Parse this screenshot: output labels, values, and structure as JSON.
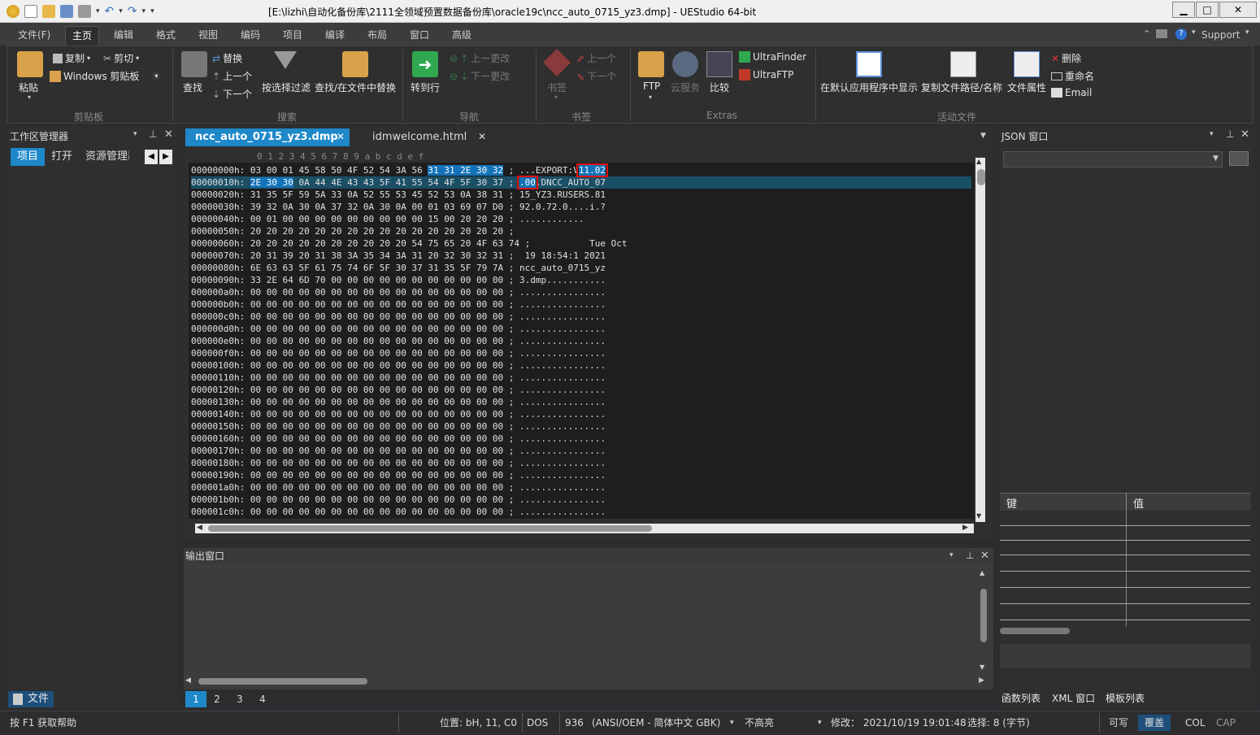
{
  "window": {
    "title": "[E:\\lizhi\\自动化备份库\\2111全领域预置数据备份库\\oracle19c\\ncc_auto_0715_yz3.dmp] - UEStudio 64-bit",
    "minimize": "▁",
    "maximize": "□",
    "close": "✕"
  },
  "menu": {
    "tabs": [
      "文件(F)",
      "主页",
      "编辑",
      "格式",
      "视图",
      "编码",
      "项目",
      "编译",
      "布局",
      "窗口",
      "高级"
    ],
    "active": "主页",
    "support": "Support"
  },
  "ribbon": {
    "clipboard": {
      "paste": "粘贴",
      "copy": "复制",
      "cut": "剪切",
      "windows_clipboard": "Windows 剪贴板",
      "label": "剪贴板"
    },
    "search": {
      "find": "查找",
      "replace": "替换",
      "prev": "上一个",
      "next": "下一个",
      "filter": "按选择过滤",
      "find_in_files": "查找/在文件中替换",
      "label": "搜索"
    },
    "nav": {
      "goto": "转到行",
      "prev_change": "上一更改",
      "next_change": "下一更改",
      "label": "导航"
    },
    "bookmarks": {
      "bookmark": "书签",
      "prev": "上一个",
      "next": "下一个",
      "label": "书签"
    },
    "extras": {
      "ftp": "FTP",
      "cloud": "云服务",
      "compare": "比较",
      "ultrafinder": "UltraFinder",
      "ultraftp": "UltraFTP",
      "label": "Extras"
    },
    "active_file": {
      "show_default": "在默认应用程序中显示",
      "copy_path": "复制文件路径/名称",
      "file_props": "文件属性",
      "delete": "删除",
      "rename": "重命名",
      "email": "Email",
      "label": "活动文件"
    }
  },
  "workspace": {
    "title": "工作区管理器",
    "tabs": [
      "项目",
      "打开",
      "资源管理器"
    ],
    "bottom_tab": "文件"
  },
  "editor": {
    "tabs": [
      {
        "label": "ncc_auto_0715_yz3.dmp",
        "active": true
      },
      {
        "label": "idmwelcome.html",
        "active": false
      }
    ],
    "column_header": "0 1 2 3 4 5 6 7 8 9 a b c d e f",
    "rows": [
      {
        "addr": "00000000h:",
        "hex": "03 00 01 45 58 50 4F 52 54 3A 56 ",
        "hexsel": "31 31 2E 30 32",
        "ascii": "...EXPORT:V",
        "asciisel": "11.02"
      },
      {
        "addr": "00000010h:",
        "hex": "",
        "hexsel": "2E 30 30",
        "hex2": " 0A 44 4E 43 43 5F 41 55 54 4F 5F 30 37",
        "ascii": "",
        "asciisel": ".00",
        "ascii2": ".DNCC_AUTO_07"
      },
      {
        "addr": "00000020h:",
        "hex": "31 35 5F 59 5A 33 0A 52 55 53 45 52 53 0A 38 31",
        "ascii": "15_YZ3.RUSERS.81"
      },
      {
        "addr": "00000030h:",
        "hex": "39 32 0A 30 0A 37 32 0A 30 0A 00 01 03 69 07 D0",
        "ascii": "92.0.72.0....i.?"
      },
      {
        "addr": "00000040h:",
        "hex": "00 01 00 00 00 00 00 00 00 00 00 15 00 20 20 20",
        "ascii": "............   "
      },
      {
        "addr": "00000050h:",
        "hex": "20 20 20 20 20 20 20 20 20 20 20 20 20 20 20 20",
        "ascii": ""
      },
      {
        "addr": "00000060h:",
        "hex": "20 20 20 20 20 20 20 20 20 20 54 75 65 20 4F 63 74",
        "ascii": "          Tue Oct"
      },
      {
        "addr": "00000070h:",
        "hex": "20 31 39 20 31 38 3A 35 34 3A 31 20 32 30 32 31",
        "ascii": " 19 18:54:1 2021"
      },
      {
        "addr": "00000080h:",
        "hex": "6E 63 63 5F 61 75 74 6F 5F 30 37 31 35 5F 79 7A",
        "ascii": "ncc_auto_0715_yz"
      },
      {
        "addr": "00000090h:",
        "hex": "33 2E 64 6D 70 00 00 00 00 00 00 00 00 00 00 00",
        "ascii": "3.dmp..........."
      },
      {
        "addr": "000000a0h:",
        "hex": "00 00 00 00 00 00 00 00 00 00 00 00 00 00 00 00",
        "ascii": "................"
      },
      {
        "addr": "000000b0h:",
        "hex": "00 00 00 00 00 00 00 00 00 00 00 00 00 00 00 00",
        "ascii": "................"
      },
      {
        "addr": "000000c0h:",
        "hex": "00 00 00 00 00 00 00 00 00 00 00 00 00 00 00 00",
        "ascii": "................"
      },
      {
        "addr": "000000d0h:",
        "hex": "00 00 00 00 00 00 00 00 00 00 00 00 00 00 00 00",
        "ascii": "................"
      },
      {
        "addr": "000000e0h:",
        "hex": "00 00 00 00 00 00 00 00 00 00 00 00 00 00 00 00",
        "ascii": "................"
      },
      {
        "addr": "000000f0h:",
        "hex": "00 00 00 00 00 00 00 00 00 00 00 00 00 00 00 00",
        "ascii": "................"
      },
      {
        "addr": "00000100h:",
        "hex": "00 00 00 00 00 00 00 00 00 00 00 00 00 00 00 00",
        "ascii": "................"
      },
      {
        "addr": "00000110h:",
        "hex": "00 00 00 00 00 00 00 00 00 00 00 00 00 00 00 00",
        "ascii": "................"
      },
      {
        "addr": "00000120h:",
        "hex": "00 00 00 00 00 00 00 00 00 00 00 00 00 00 00 00",
        "ascii": "................"
      },
      {
        "addr": "00000130h:",
        "hex": "00 00 00 00 00 00 00 00 00 00 00 00 00 00 00 00",
        "ascii": "................"
      },
      {
        "addr": "00000140h:",
        "hex": "00 00 00 00 00 00 00 00 00 00 00 00 00 00 00 00",
        "ascii": "................"
      },
      {
        "addr": "00000150h:",
        "hex": "00 00 00 00 00 00 00 00 00 00 00 00 00 00 00 00",
        "ascii": "................"
      },
      {
        "addr": "00000160h:",
        "hex": "00 00 00 00 00 00 00 00 00 00 00 00 00 00 00 00",
        "ascii": "................"
      },
      {
        "addr": "00000170h:",
        "hex": "00 00 00 00 00 00 00 00 00 00 00 00 00 00 00 00",
        "ascii": "................"
      },
      {
        "addr": "00000180h:",
        "hex": "00 00 00 00 00 00 00 00 00 00 00 00 00 00 00 00",
        "ascii": "................"
      },
      {
        "addr": "00000190h:",
        "hex": "00 00 00 00 00 00 00 00 00 00 00 00 00 00 00 00",
        "ascii": "................"
      },
      {
        "addr": "000001a0h:",
        "hex": "00 00 00 00 00 00 00 00 00 00 00 00 00 00 00 00",
        "ascii": "................"
      },
      {
        "addr": "000001b0h:",
        "hex": "00 00 00 00 00 00 00 00 00 00 00 00 00 00 00 00",
        "ascii": "................"
      },
      {
        "addr": "000001c0h:",
        "hex": "00 00 00 00 00 00 00 00 00 00 00 00 00 00 00 00",
        "ascii": "................"
      }
    ]
  },
  "output": {
    "title": "输出窗口",
    "pages": [
      "1",
      "2",
      "3",
      "4"
    ],
    "active_page": "1"
  },
  "json_panel": {
    "title": "JSON 窗口",
    "col_key": "键",
    "col_value": "值",
    "bottom_tabs": [
      "函数列表",
      "XML 窗口",
      "模板列表"
    ]
  },
  "status": {
    "help": "按 F1 获取帮助",
    "position": "位置: bH, 11, C0",
    "lineend": "DOS",
    "codepage": "936",
    "encoding": "(ANSI/OEM - 简体中文 GBK)",
    "highlight": "不高亮",
    "modified": "修改： 2021/10/19 19:01:48",
    "selection": "选择: 8 (字节)",
    "writable": "可写",
    "overwrite": "覆盖",
    "col": "COL",
    "cap": "CAP"
  },
  "colors": {
    "accent": "#1e88c9",
    "highlight_box": "#e01010",
    "hex_bg": "#1e1e1e"
  }
}
